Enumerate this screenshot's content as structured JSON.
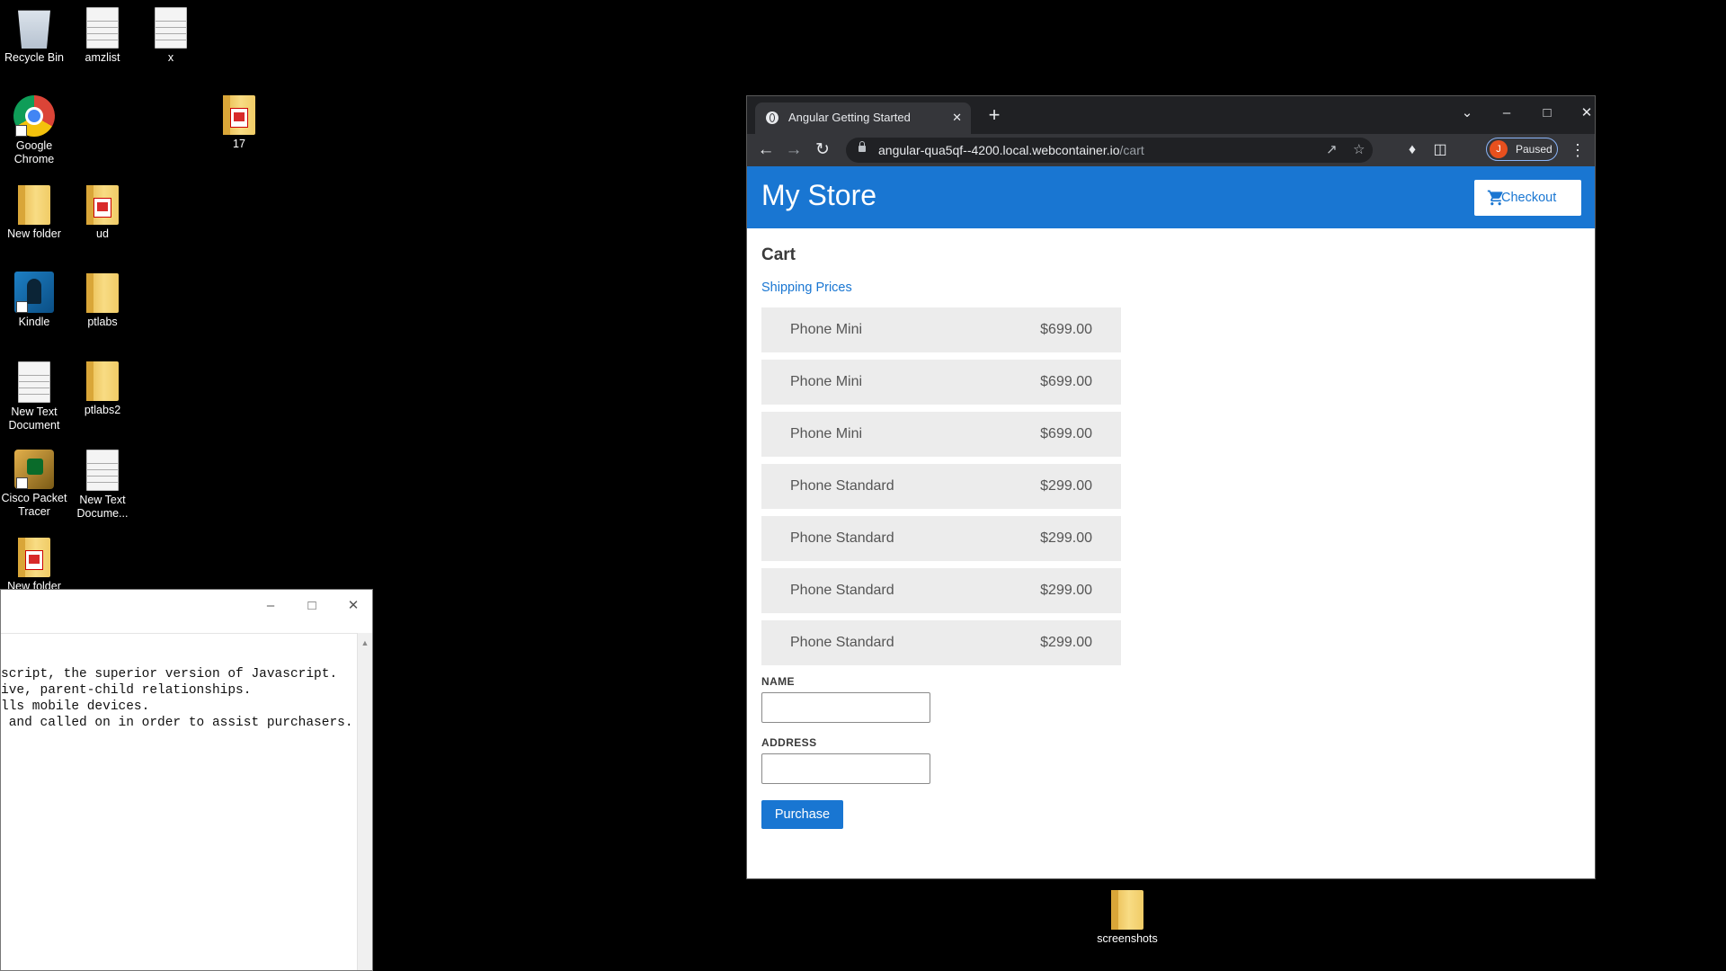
{
  "desktop": {
    "icons": [
      {
        "label": "Recycle Bin",
        "icon": "recycle-bin-icon"
      },
      {
        "label": "amzlist",
        "icon": "text-file-icon"
      },
      {
        "label": "x",
        "icon": "text-file-icon"
      },
      {
        "label": "Google Chrome",
        "icon": "chrome-icon"
      },
      {
        "label": "17",
        "icon": "pdf-folder-icon"
      },
      {
        "label": "New folder",
        "icon": "folder-icon"
      },
      {
        "label": "ud",
        "icon": "pdf-folder-icon"
      },
      {
        "label": "Kindle",
        "icon": "kindle-icon"
      },
      {
        "label": "ptlabs",
        "icon": "folder-icon"
      },
      {
        "label": "New Text Document",
        "icon": "text-file-icon"
      },
      {
        "label": "ptlabs2",
        "icon": "folder-icon"
      },
      {
        "label": "Cisco Packet Tracer",
        "icon": "cisco-packet-tracer-icon"
      },
      {
        "label": "New Text Docume...",
        "icon": "text-file-icon"
      },
      {
        "label": "New folder",
        "icon": "pdf-folder-icon"
      },
      {
        "label": "screenshots",
        "icon": "folder-icon"
      }
    ]
  },
  "notepad": {
    "lines": [
      "script, the superior version of Javascript.",
      "ive, parent-child relationships.",
      "lls mobile devices.",
      " and called on in order to assist purchasers."
    ]
  },
  "browser": {
    "tab_title": "Angular Getting Started",
    "url_host": "angular-qua5qf--4200.local.webcontainer.io",
    "url_path": "/cart",
    "profile_initial": "J",
    "profile_status": "Paused"
  },
  "page": {
    "store_title": "My Store",
    "checkout_label": "Checkout",
    "cart_heading": "Cart",
    "shipping_link": "Shipping Prices",
    "items": [
      {
        "name": "Phone Mini",
        "price": "$699.00"
      },
      {
        "name": "Phone Mini",
        "price": "$699.00"
      },
      {
        "name": "Phone Mini",
        "price": "$699.00"
      },
      {
        "name": "Phone Standard",
        "price": "$299.00"
      },
      {
        "name": "Phone Standard",
        "price": "$299.00"
      },
      {
        "name": "Phone Standard",
        "price": "$299.00"
      },
      {
        "name": "Phone Standard",
        "price": "$299.00"
      }
    ],
    "name_label": "NAME",
    "name_value": "",
    "address_label": "ADDRESS",
    "address_value": "",
    "purchase_label": "Purchase"
  },
  "colors": {
    "accent": "#1976d2",
    "item_bg": "#ececec",
    "browser_chrome": "#35363a"
  }
}
